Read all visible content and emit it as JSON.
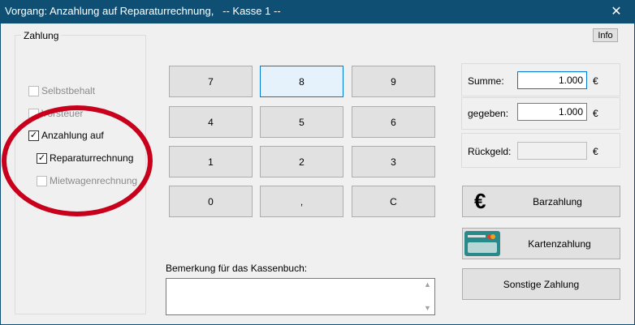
{
  "window": {
    "title": "Vorgang: Anzahlung auf Reparaturrechnung,   -- Kasse 1 --",
    "close_glyph": "✕"
  },
  "info_button": "Info",
  "zahlung": {
    "legend": "Zahlung",
    "checkboxes": [
      {
        "label": "Selbstbehalt",
        "checked": false,
        "enabled": false
      },
      {
        "label": "Vorsteuer",
        "checked": false,
        "enabled": false
      },
      {
        "label": "Anzahlung auf",
        "checked": true,
        "enabled": true
      },
      {
        "label": "Reparaturrechnung",
        "checked": true,
        "enabled": true
      },
      {
        "label": "Mietwagenrechnung",
        "checked": false,
        "enabled": false
      }
    ]
  },
  "keypad": {
    "keys": [
      "7",
      "8",
      "9",
      "4",
      "5",
      "6",
      "1",
      "2",
      "3",
      "0",
      ",",
      "C"
    ]
  },
  "bemerkung": {
    "label": "Bemerkung für das Kassenbuch:",
    "value": ""
  },
  "fields": {
    "summe": {
      "label": "Summe:",
      "value": "1.000",
      "currency": "€"
    },
    "gegeben": {
      "label": "gegeben:",
      "value": "1.000",
      "currency": "€"
    },
    "rueckgeld": {
      "label": "Rückgeld:",
      "value": "",
      "currency": "€"
    }
  },
  "payment_buttons": {
    "bar": {
      "label": "Barzahlung",
      "icon": "euro-icon",
      "icon_glyph": "€"
    },
    "karte": {
      "label": "Kartenzahlung",
      "icon": "credit-card-icon"
    },
    "sonstige": {
      "label": "Sonstige Zahlung"
    }
  },
  "colors": {
    "titlebar": "#0e4f73",
    "highlight_ellipse": "#c8001c",
    "focus_border": "#0078d7"
  }
}
